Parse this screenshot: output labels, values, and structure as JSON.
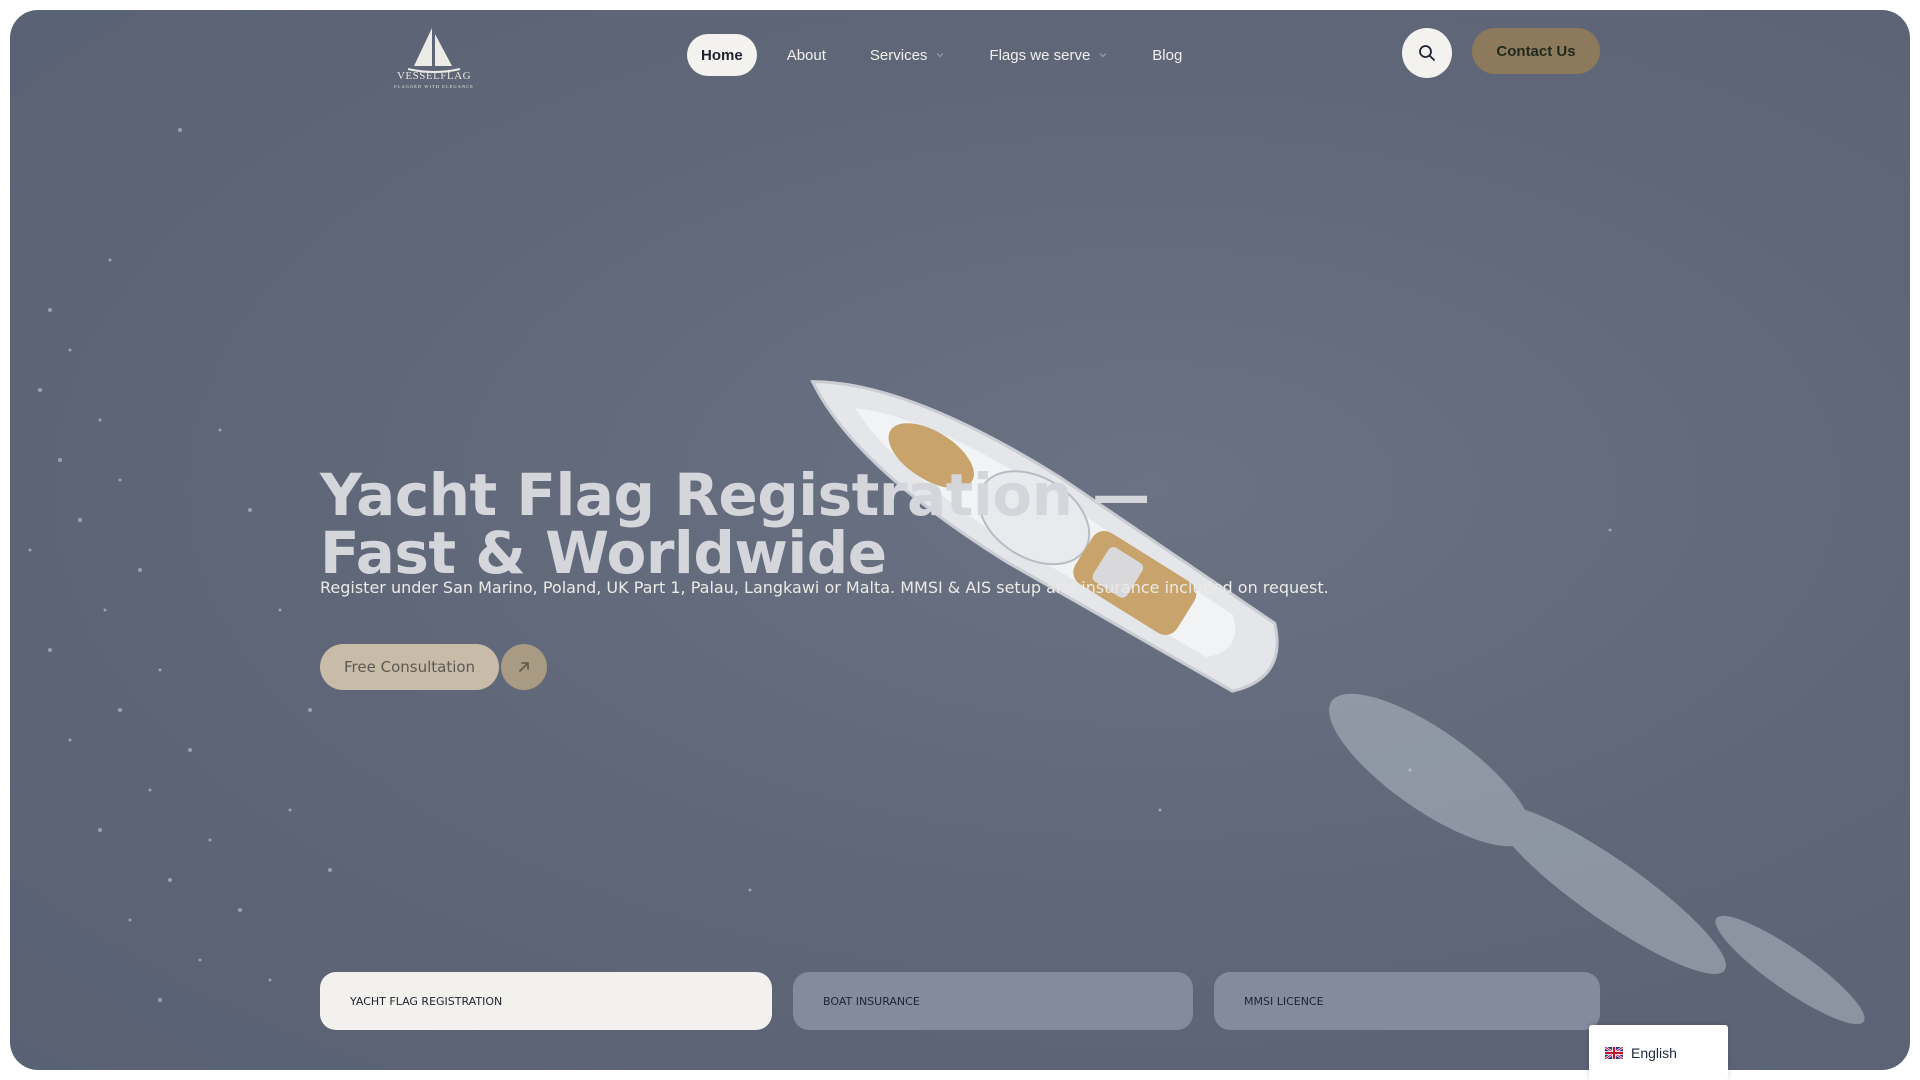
{
  "brand": {
    "name": "VESSELFLAG",
    "tagline": "FLAGGED WITH ELEGANCE"
  },
  "nav": {
    "items": [
      {
        "label": "Home",
        "active": true
      },
      {
        "label": "About"
      },
      {
        "label": "Services",
        "has_dropdown": true
      },
      {
        "label": "Flags we serve",
        "has_dropdown": true
      },
      {
        "label": "Blog"
      }
    ]
  },
  "header": {
    "search_icon": "search-icon",
    "contact_label": "Contact Us"
  },
  "hero": {
    "title_line1": "Yacht Flag Registration —",
    "title_line2": "Fast & Worldwide",
    "subtitle": "Register under San Marino, Poland, UK Part 1, Palau, Langkawi or Malta. MMSI & AIS setup and insurance included on request.",
    "cta_label": "Free Consultation",
    "cta_icon": "arrow-up-right-icon"
  },
  "tabs": [
    {
      "label": "YACHT FLAG REGISTRATION",
      "active": true
    },
    {
      "label": "BOAT INSURANCE"
    },
    {
      "label": "MMSI LICENCE"
    }
  ],
  "language": {
    "label": "English",
    "flag_icon": "uk-flag-icon"
  },
  "colors": {
    "overlay": "#5e6677",
    "accent": "#8d7a5c",
    "cta": "#c8bca8",
    "tab_active": "#f2f1ee",
    "tab_inactive": "#838b9c"
  }
}
